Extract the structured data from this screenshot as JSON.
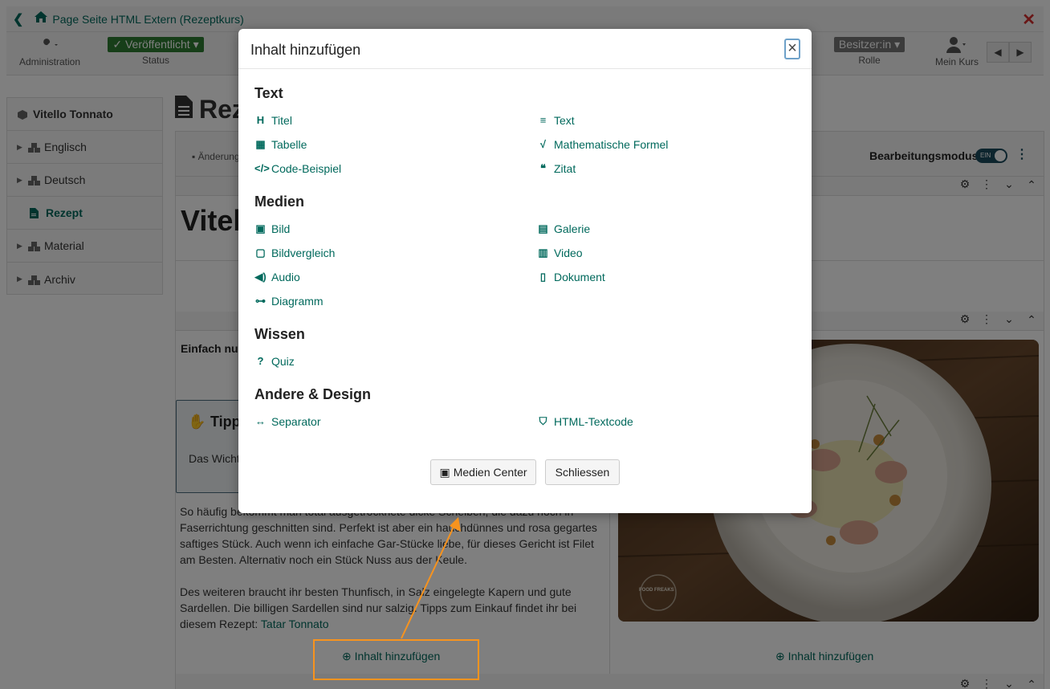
{
  "topbar": {
    "title": "Page Seite HTML Extern (Rezeptkurs)"
  },
  "toolbar": {
    "administration": "Administration",
    "status_value": "✓ Veröffentlicht ▾",
    "status_label": "Status",
    "owner_value": "Besitzer:in ▾",
    "role_label": "Rolle",
    "mycourse_label": "Mein Kurs"
  },
  "sidebar": {
    "course": "Vitello Tonnato",
    "items": [
      {
        "label": "Englisch"
      },
      {
        "label": "Deutsch"
      },
      {
        "label": "Rezept"
      },
      {
        "label": "Material"
      },
      {
        "label": "Archiv"
      }
    ]
  },
  "page": {
    "title_partial": "Rezept",
    "changes": "Änderungen",
    "edit_mode": "Bearbeitungsmodus",
    "toggle": "EIN",
    "heading_partial": "Vitel",
    "lead_partial": "Einfach nur",
    "tip_title": "Tipp",
    "tip_text": "Das Wicht",
    "para1_l1": "So häufig bekommt man total ausgetrocknete dicke Scheiben, die dazu noch in",
    "para1_l2": "Faserrichtung geschnitten sind. Perfekt ist aber ein hauchdünnes und rosa gegartes",
    "para1_l3": "saftiges Stück. Auch wenn ich einfache Gar-Stücke liebe, für dieses Gericht ist Filet",
    "para1_l4": "am Besten. Alternativ noch ein Stück Nuss aus der Keule.",
    "para2_l1": "Des weiteren braucht ihr besten Thunfisch, in Salz eingelegte Kapern und gute",
    "para2_l2": "Sardellen. Die billigen Sardellen sind nur salzig. Tipps zum Einkauf findet ihr bei",
    "para2_l3_prefix": "diesem Rezept:",
    "para2_link": "Tatar Tonnato",
    "add_content": "Inhalt hinzufügen",
    "photo_stamp": "FOOD FREAKS"
  },
  "modal": {
    "title": "Inhalt hinzufügen",
    "sections": {
      "text": "Text",
      "media": "Medien",
      "knowledge": "Wissen",
      "other": "Andere & Design"
    },
    "items": {
      "titel": "Titel",
      "text": "Text",
      "tabelle": "Tabelle",
      "formel": "Mathematische Formel",
      "code": "Code-Beispiel",
      "zitat": "Zitat",
      "bild": "Bild",
      "galerie": "Galerie",
      "bildvergleich": "Bildvergleich",
      "video": "Video",
      "audio": "Audio",
      "dokument": "Dokument",
      "diagramm": "Diagramm",
      "quiz": "Quiz",
      "separator": "Separator",
      "html": "HTML-Textcode"
    },
    "buttons": {
      "media_center": "Medien Center",
      "close": "Schliessen"
    }
  }
}
